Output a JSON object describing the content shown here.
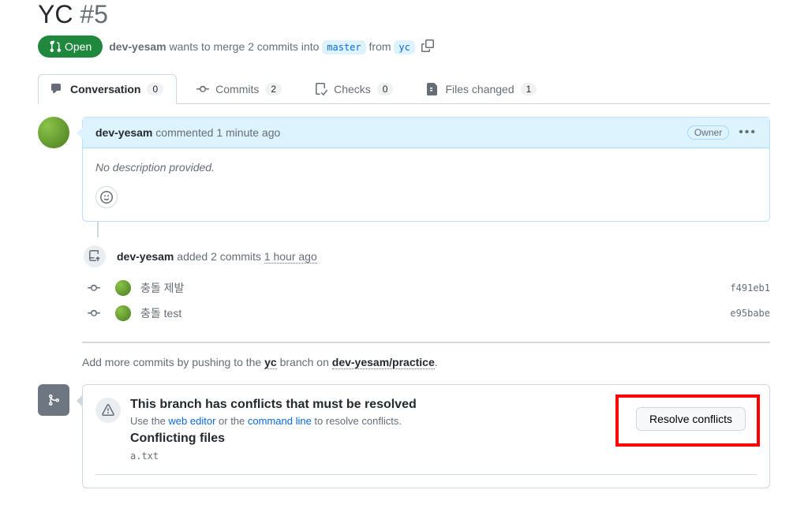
{
  "pr": {
    "title": "YC",
    "number": "#5",
    "state": "Open",
    "author": "dev-yesam",
    "merge_text_1": "wants to merge 2 commits into",
    "base_branch": "master",
    "merge_text_2": "from",
    "head_branch": "yc"
  },
  "tabs": {
    "conversation": {
      "label": "Conversation",
      "count": "0"
    },
    "commits": {
      "label": "Commits",
      "count": "2"
    },
    "checks": {
      "label": "Checks",
      "count": "0"
    },
    "files": {
      "label": "Files changed",
      "count": "1"
    }
  },
  "comment": {
    "author": "dev-yesam",
    "action": "commented",
    "time": "1 minute ago",
    "owner_badge": "Owner",
    "body": "No description provided."
  },
  "commits_event": {
    "author": "dev-yesam",
    "text": "added 2 commits",
    "time": "1 hour ago"
  },
  "commits": [
    {
      "msg": "충돌 제발",
      "sha": "f491eb1"
    },
    {
      "msg": "충돌 test",
      "sha": "e95babe"
    }
  ],
  "push_hint": {
    "prefix": "Add more commits by pushing to the",
    "branch": "yc",
    "middle": "branch on",
    "repo": "dev-yesam/practice"
  },
  "conflict": {
    "title": "This branch has conflicts that must be resolved",
    "subtitle_prefix": "Use the ",
    "web_editor": "web editor",
    "subtitle_mid": " or the ",
    "command_line": "command line",
    "subtitle_suffix": " to resolve conflicts.",
    "files_heading": "Conflicting files",
    "file": "a.txt",
    "resolve_btn": "Resolve conflicts"
  }
}
